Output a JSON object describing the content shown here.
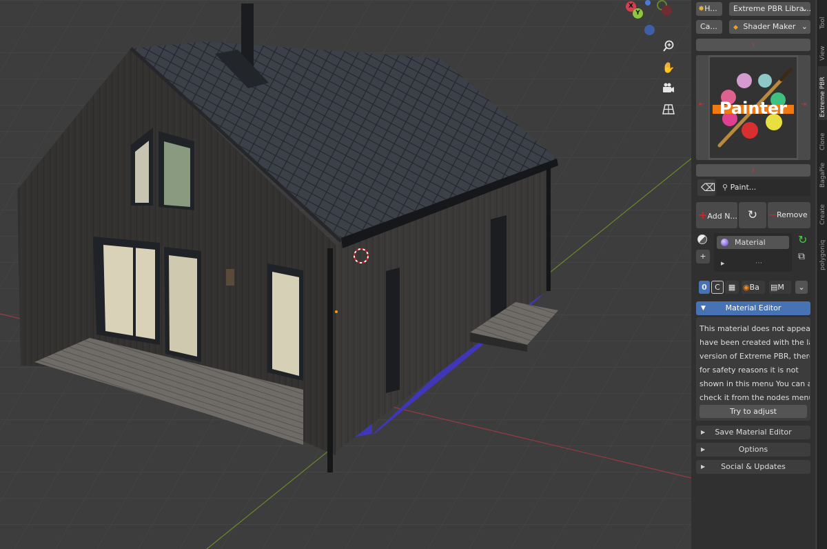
{
  "viewport": {
    "gizmo": {
      "x_label": "X",
      "y_label": "Y"
    },
    "nav_icons": [
      "zoom-icon",
      "hand-pan-icon",
      "camera-icon",
      "grid-view-icon"
    ]
  },
  "sidebar": {
    "row1": {
      "left_label": "H...",
      "dropdown": "Extreme PBR Libra..."
    },
    "row2": {
      "left_label": "Ca...",
      "dropdown": "Shader Maker"
    },
    "preview_image_text": "Painter",
    "search_value": "Paint...",
    "actions": {
      "add": "Add N...",
      "remove": "Remove"
    },
    "material_slot": "Material",
    "mode_buttons": {
      "zero": "0",
      "c": "C",
      "ba": "Ba",
      "m": "M"
    },
    "material_editor_header": "Material Editor",
    "info_lines": [
      "This material does not appear ...",
      "have been created with the la...",
      "version of Extreme PBR, there...",
      "for safety reasons it is not",
      "shown in this menu You can al...",
      "check it from the nodes menu"
    ],
    "try_adjust": "Try to adjust",
    "sections": [
      "Save Material Editor",
      "Options",
      "Social & Updates"
    ]
  },
  "tabs": [
    "Tool",
    "View",
    "Extreme PBR",
    "Clone",
    "BagaPie",
    "Create",
    "polygoniq"
  ],
  "colors": {
    "accent": "#4772b3",
    "panel": "#303030",
    "viewport": "#3d3d3d"
  }
}
